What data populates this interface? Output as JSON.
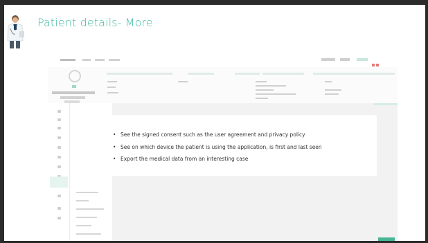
{
  "slide": {
    "title": "Patient details- More",
    "title_color": "#3fb9a1",
    "illustration": "doctor-illustration"
  },
  "callout": {
    "bullets": [
      "See the signed consent such as the user agreement and privacy policy",
      "See on which device the patient is using the application, is first and last seen",
      "Export the medical data from an interesting case"
    ]
  },
  "screenshot": {
    "accent_color": "#48b595",
    "alert_color": "#e37b7b"
  }
}
